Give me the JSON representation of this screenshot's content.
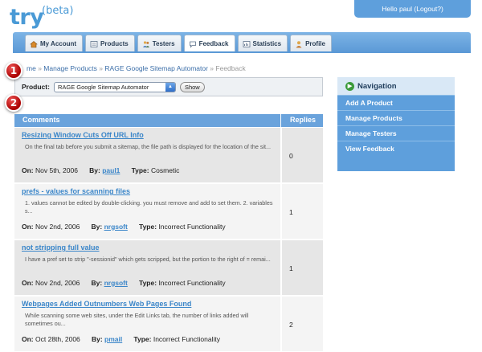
{
  "header": {
    "logo": "try",
    "logo_suffix": "(beta)",
    "user_text": "Hello paul (Logout?)"
  },
  "tabs": [
    {
      "label": "My Account",
      "icon": "home-icon"
    },
    {
      "label": "Products",
      "icon": "list-icon"
    },
    {
      "label": "Testers",
      "icon": "people-icon"
    },
    {
      "label": "Feedback",
      "icon": "speech-bubble-icon"
    },
    {
      "label": "Statistics",
      "icon": "chart-icon"
    },
    {
      "label": "Profile",
      "icon": "person-icon"
    }
  ],
  "breadcrumb": {
    "home": "me",
    "sep": "»",
    "manage_products": "Manage Products",
    "product": "RAGE Google Sitemap Automator",
    "current": "Feedback"
  },
  "badges": [
    "1",
    "2"
  ],
  "product_selector": {
    "label": "Product:",
    "selected": "RAGE Google Sitemap Automator",
    "button": "Show"
  },
  "comments_table": {
    "header_comments": "Comments",
    "header_replies": "Replies",
    "on_label": "On:",
    "by_label": "By:",
    "type_label": "Type:",
    "rows": [
      {
        "title": "Resizing Window Cuts Off URL Info",
        "description": "On the final tab before you submit a sitemap, the file path is displayed for the location of the sit...",
        "date": "Nov 5th, 2006",
        "user": "paul1",
        "type": "Cosmetic",
        "replies": "0"
      },
      {
        "title": "prefs - values for scanning files",
        "description": "1. values cannot be edited by double-clicking. you must remove and add to set them. 2. variables s...",
        "date": "Nov 2nd, 2006",
        "user": "nrgsoft",
        "type": "Incorrect Functionality",
        "replies": "1"
      },
      {
        "title": "not stripping full value",
        "description": "I have a pref set to strip \"-sessionid\" which gets scripped, but the portion to the right of = remai...",
        "date": "Nov 2nd, 2006",
        "user": "nrgsoft",
        "type": "Incorrect Functionality",
        "replies": "1"
      },
      {
        "title": "Webpages Added Outnumbers Web Pages Found",
        "description": "While scanning some web sites, under the Edit Links tab, the number of links added will sometimes ou...",
        "date": "Oct 28th, 2006",
        "user": "pmail",
        "type": "Incorrect Functionality",
        "replies": "2"
      }
    ]
  },
  "navigation": {
    "title": "Navigation",
    "items": [
      "Add A Product",
      "Manage Products",
      "Manage Testers",
      "View Feedback"
    ]
  }
}
